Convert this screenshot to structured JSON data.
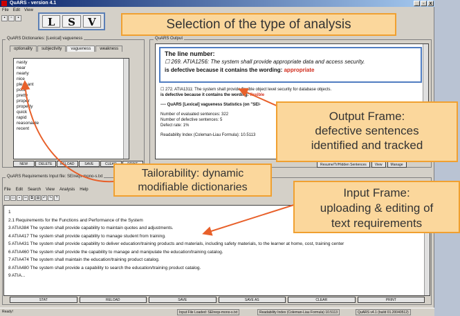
{
  "window": {
    "title": "QuARS - version 4.1",
    "buttons": [
      "_",
      "▫",
      "X"
    ]
  },
  "menu": [
    "File",
    "Edit",
    "View"
  ],
  "analysis_types": [
    "L",
    "S",
    "V"
  ],
  "dictionary_panel": {
    "title": "QuARS Dictionaries: [Lexical] vagueness",
    "tabs": [
      "optionality",
      "subjectivity",
      "vagueness",
      "weakness"
    ],
    "active_tab": "vagueness",
    "words": [
      "nasty",
      "near",
      "nearly",
      "nice",
      "pleasant",
      "poor",
      "pretty",
      "proper",
      "properly",
      "quick",
      "rapid",
      "reasonable",
      "recent"
    ],
    "buttons": [
      "NEW",
      "DELETE",
      "RELOAD",
      "SAVE",
      "CLEAR",
      "PRINT"
    ]
  },
  "output_panel": {
    "title": "QuARS Output",
    "highlight": {
      "heading": "The line number:",
      "sentence": "269. ATIA1256: The system shall provide appropriate data and access security.",
      "verdict_prefix": "is defective because it contains the wording: ",
      "word": "appropriate"
    },
    "second_sentence": "272. ATIA1311: The system shall provide flexible object level security for database objects.",
    "second_verdict_prefix": "is defective because it contains the wording: ",
    "second_word": "flexible",
    "stats_heading": "---- QuARS [Lexical] vagueness Statistics (on \"SEI-",
    "stats": [
      "Number of evaluated sentences: 322",
      "Number of defective sentences: 5",
      "Defect rate: 1%"
    ],
    "readability": "Readability Index (Coleman-Liau Formula): 10.5113",
    "buttons": [
      "Resume/Tr/Hidden Sentences",
      "View",
      "Manage"
    ]
  },
  "input_panel": {
    "title": "QuARS Requirements Input file: SEIreqs-mono-s.txt",
    "menu": [
      "File",
      "Edit",
      "Search",
      "View",
      "Analysis",
      "Help"
    ],
    "lines": [
      "1",
      "2.1  Requirements for the Functions and Performance of the System",
      "3 ATIA384  The system shall provide capability to maintain quotes and adjustments.",
      "4 ATIA417  The system shall provide capability to manage student from training.",
      "5 ATIA431  The system shall provide capability to deliver education/training products and materials, including safety materials, to the learner at home, cost, training center",
      "6 ATIA460  The system shall provide the capability to manage and manipulate the education/training catalog.",
      "7 ATIA474  The system shall maintain the education/training product catalog.",
      "8 ATIA480  The system shall provide a capability to search the education/training product catalog.",
      "9 ATIA..."
    ],
    "buttons": [
      "STAT",
      "RELOAD",
      "SAVE",
      "SAVE AS",
      "CLEAR",
      "PRINT"
    ]
  },
  "status_bar": {
    "ready": "Ready!",
    "file": "Input File Loaded: SEIreqs-mono-s.txt",
    "readability": "Readability Index (Coleman-Liau Formula) 10.5113",
    "version": "QuARS v4.1 (build 01.20040512)"
  },
  "callouts": {
    "analysis": "Selection of the type of analysis",
    "output": [
      "Output Frame:",
      "defective sentences",
      "identified and tracked"
    ],
    "tailor": [
      "Tailorability: dynamic",
      "modifiable dictionaries"
    ],
    "input": [
      "Input Frame:",
      "uploading & editing of",
      "text requirements"
    ]
  },
  "colors": {
    "callout_fill": "#fbd79c",
    "callout_border": "#f0a030",
    "arrow": "#e8602a",
    "defect_word": "#d02a1a"
  }
}
